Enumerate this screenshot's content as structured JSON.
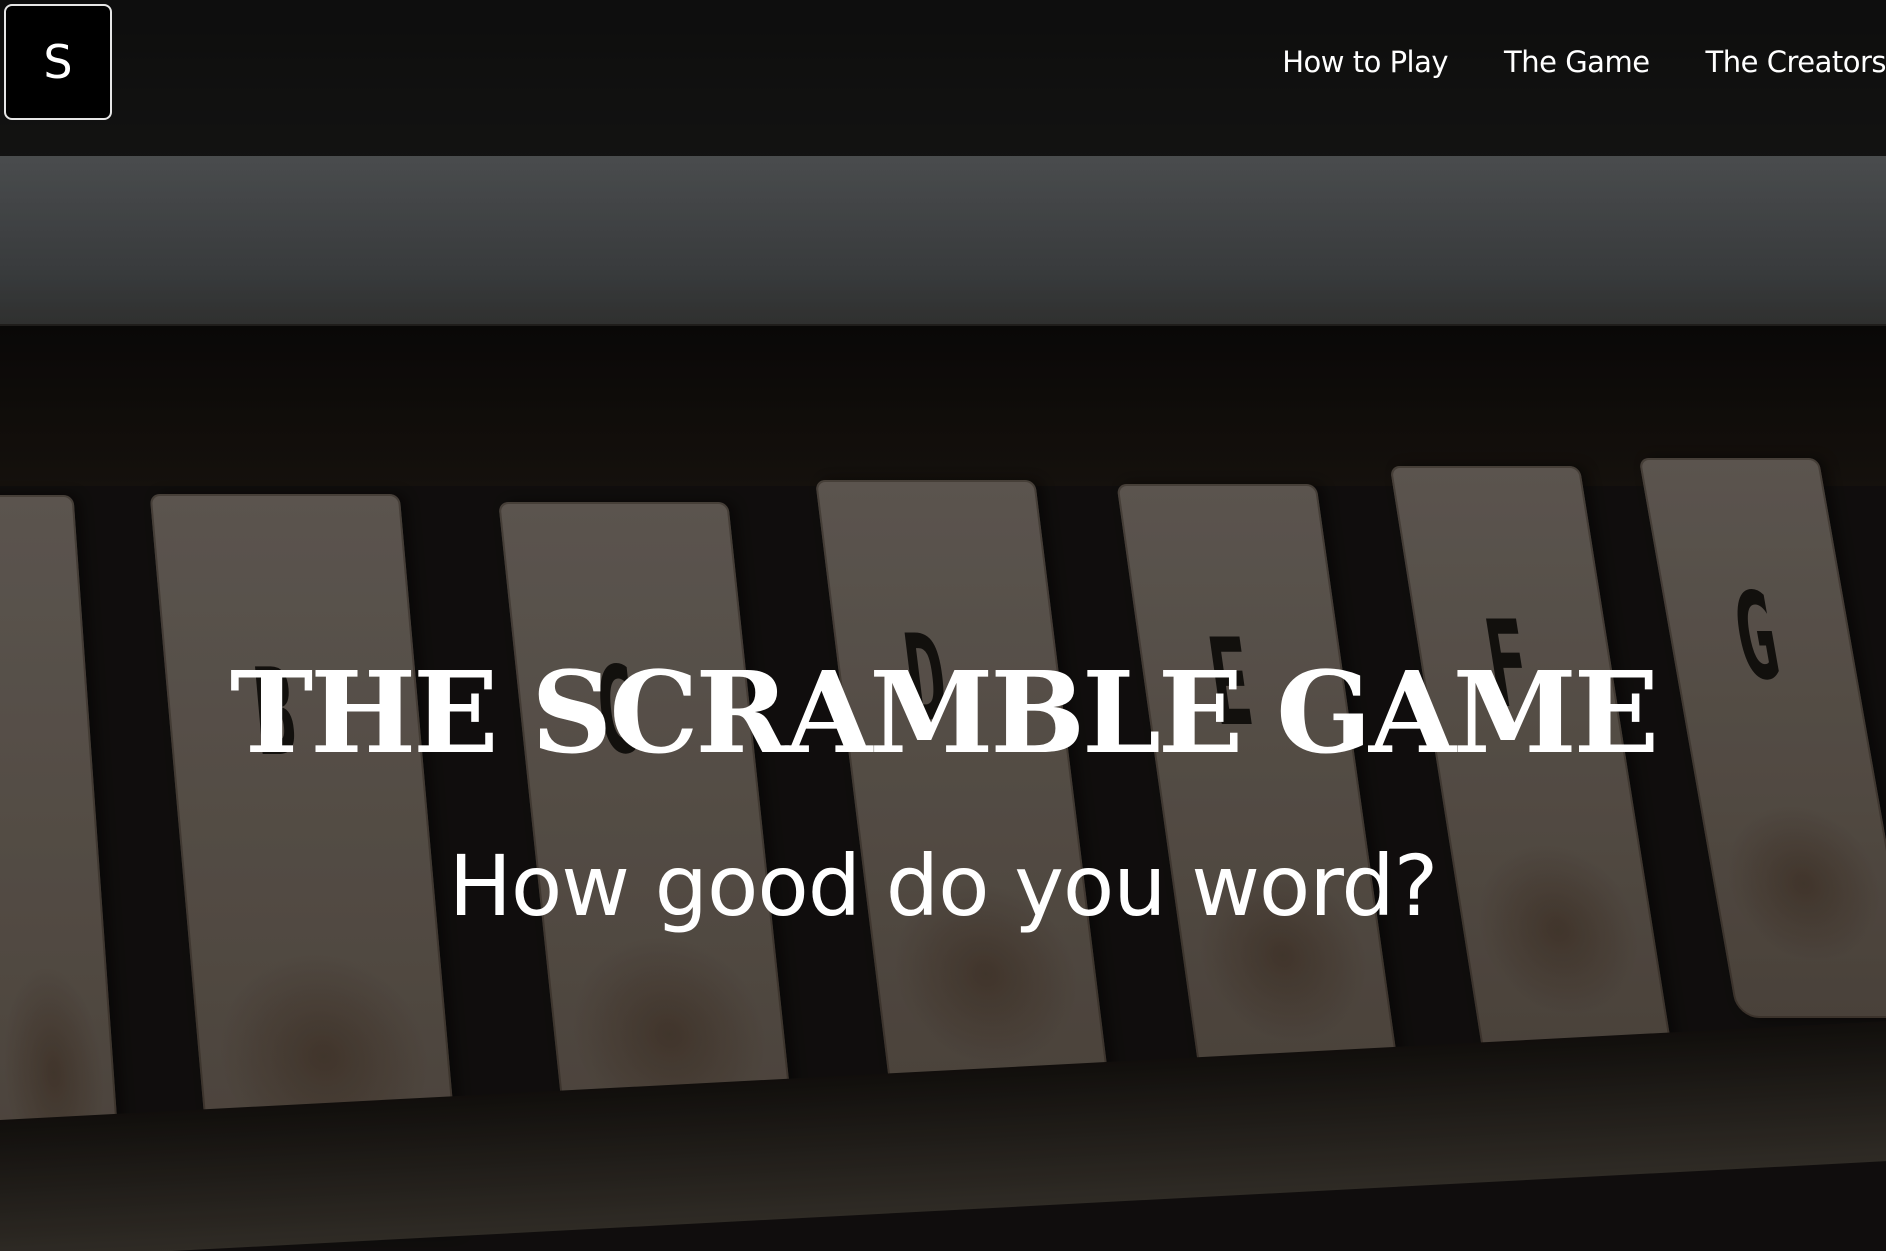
{
  "nav": {
    "brand_label": "S",
    "links": [
      {
        "label": "How to Play"
      },
      {
        "label": "The Game"
      },
      {
        "label": "The Creators"
      }
    ]
  },
  "hero": {
    "title": "THE SCRAMBLE GAME",
    "subtitle": "How good do you word?",
    "background_key_letters": [
      "B",
      "C",
      "D",
      "E",
      "F",
      "G"
    ]
  },
  "colors": {
    "nav_background": "#0a0a0a",
    "text": "#ffffff",
    "brand_border": "#e6e6e6"
  }
}
